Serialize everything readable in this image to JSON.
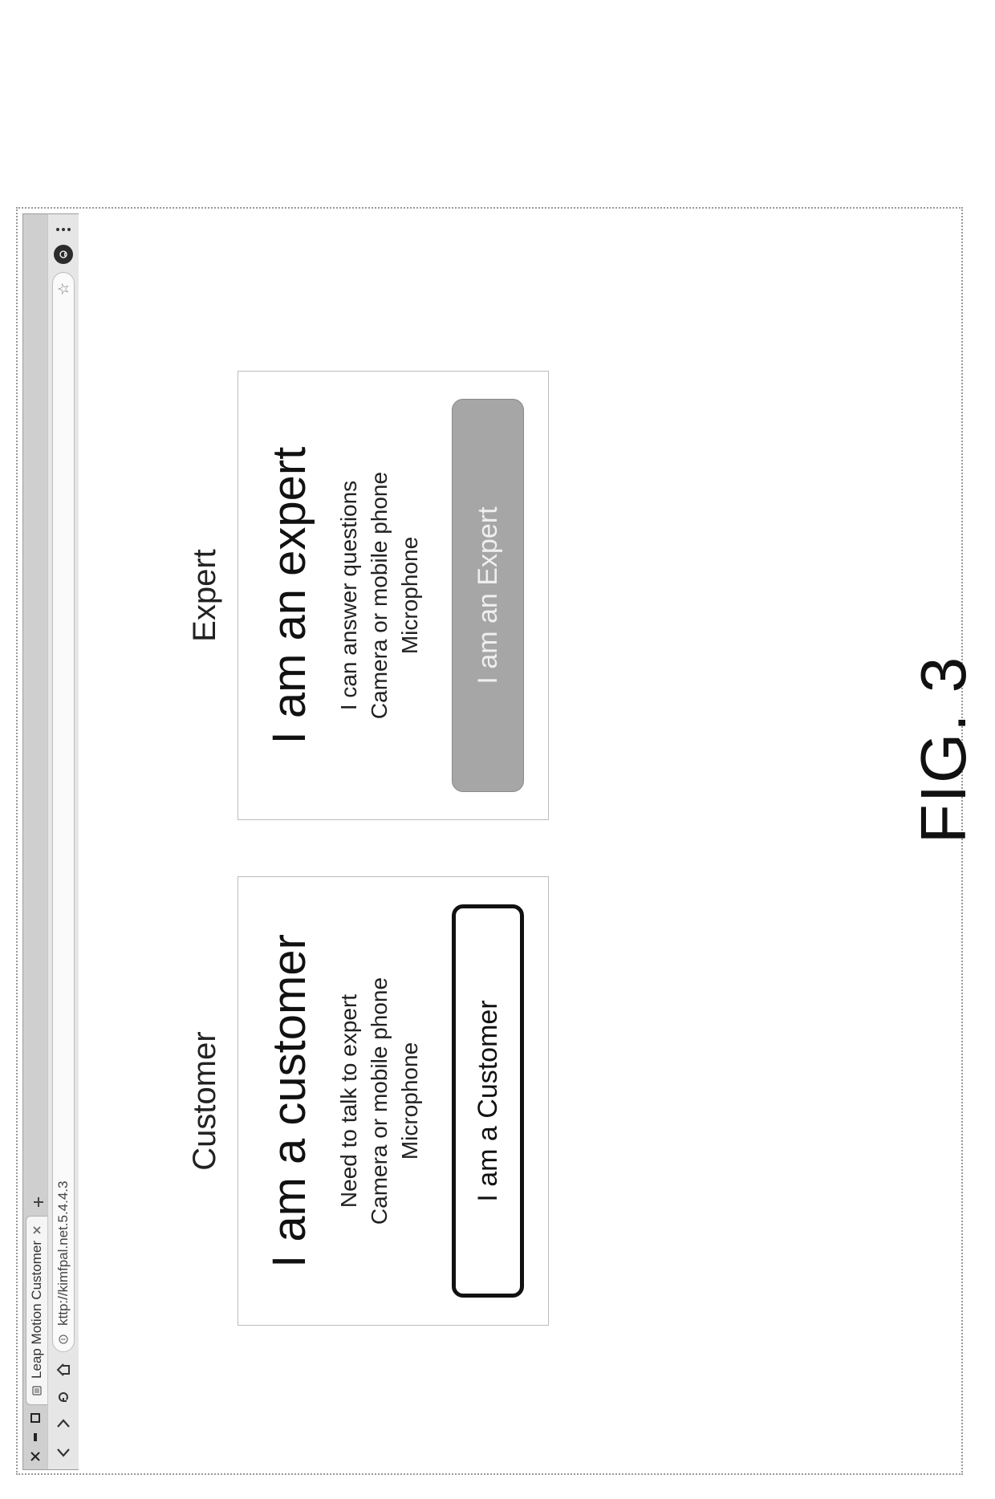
{
  "window": {
    "tab_title": "Leap Motion Customer",
    "url": "kttp://kimfpal.net.5.4.4.3"
  },
  "page": {
    "customer": {
      "label": "Customer",
      "headline": "I am a customer",
      "line1": "Need to talk to expert",
      "line2": "Camera or mobile phone",
      "line3": "Microphone",
      "button_label": "I am a Customer"
    },
    "expert": {
      "label": "Expert",
      "headline": "I am an expert",
      "line1": "I can answer questions",
      "line2": "Camera or mobile phone",
      "line3": "Microphone",
      "button_label": "I am an Expert"
    }
  },
  "figure_caption": "FIG. 3"
}
